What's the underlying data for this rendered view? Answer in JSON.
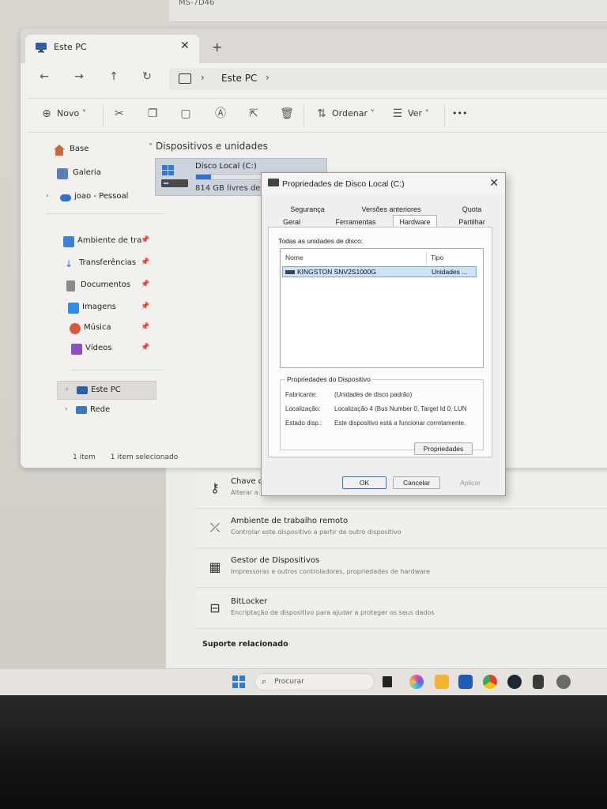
{
  "settings_window": {
    "top_label": "MS-7D46",
    "cards": [
      {
        "title": "Chave de p",
        "subtitle": "Alterar a cha",
        "icon": "key-icon"
      },
      {
        "title": "Ambiente de trabalho remoto",
        "subtitle": "Controlar este dispositivo a partir de outro dispositivo",
        "icon": "remote-desktop-icon"
      },
      {
        "title": "Gestor de Dispositivos",
        "subtitle": "Impressoras e outros controladores, propriedades de hardware",
        "icon": "device-manager-icon"
      },
      {
        "title": "BitLocker",
        "subtitle": "Encriptação de dispositivo para ajudar a proteger os seus dados",
        "icon": "bitlocker-icon"
      }
    ],
    "support_title": "Suporte relacionado"
  },
  "explorer": {
    "tab_title": "Este PC",
    "tab_close": "✕",
    "new_tab": "+",
    "breadcrumb": "Este PC",
    "toolbar": {
      "new_label": "Novo",
      "sort_label": "Ordenar",
      "view_label": "Ver",
      "more": "•••"
    },
    "sidebar": {
      "items": [
        {
          "label": "Base",
          "icon": "home-icon"
        },
        {
          "label": "Galeria",
          "icon": "gallery-icon"
        },
        {
          "label": "joao - Pessoal",
          "icon": "onedrive-icon"
        },
        {
          "label": "Ambiente de tra",
          "icon": "desktop-icon"
        },
        {
          "label": "Transferências",
          "icon": "download-icon"
        },
        {
          "label": "Documentos",
          "icon": "documents-icon"
        },
        {
          "label": "Imagens",
          "icon": "pictures-icon"
        },
        {
          "label": "Música",
          "icon": "music-icon"
        },
        {
          "label": "Vídeos",
          "icon": "videos-icon"
        },
        {
          "label": "Este PC",
          "icon": "this-pc-icon"
        },
        {
          "label": "Rede",
          "icon": "network-icon"
        }
      ]
    },
    "section_title": "Dispositivos e unidades",
    "drive": {
      "name": "Disco Local (C:)",
      "free": "814 GB livres de 93",
      "used_fraction": 0.12
    },
    "status": {
      "items": "1 item",
      "selected": "1 item selecionado"
    }
  },
  "dialog": {
    "title": "Propriedades de Disco Local (C:)",
    "close": "✕",
    "tabs_row1": [
      "Segurança",
      "Versões anteriores",
      "Quota"
    ],
    "tabs_row2": [
      "Geral",
      "Ferramentas",
      "Hardware",
      "Partilhar"
    ],
    "all_disks_label": "Todas as unidades de disco:",
    "columns": [
      "Nome",
      "Tipo"
    ],
    "disk_row": {
      "name": "KINGSTON SNV2S1000G",
      "type": "Unidades ..."
    },
    "device_props_title": "Propriedades do Dispositivo",
    "props": [
      {
        "key": "Fabricante:",
        "value": "(Unidades de disco padrão)"
      },
      {
        "key": "Localização:",
        "value": "Localização 4 (Bus Number 0, Target Id 0, LUN"
      },
      {
        "key": "Estado disp.:",
        "value": "Este dispositivo está a funcionar corretamente."
      }
    ],
    "properties_button": "Propriedades",
    "ok_button": "OK",
    "cancel_button": "Cancelar",
    "apply_button": "Aplicar"
  },
  "taskbar": {
    "search_placeholder": "Procurar"
  },
  "colors": {
    "accent": "#2673d9",
    "selection": "#cfe1f5"
  }
}
